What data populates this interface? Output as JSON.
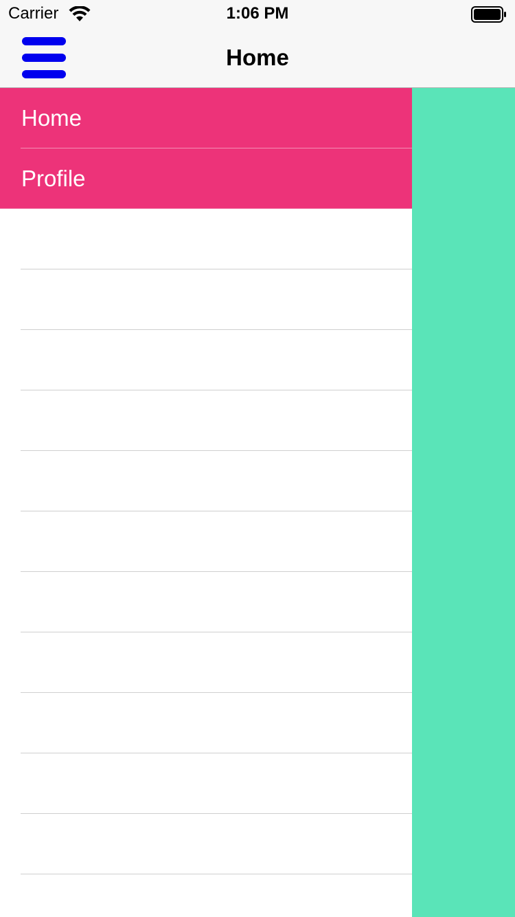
{
  "status_bar": {
    "carrier": "Carrier",
    "time": "1:06 PM",
    "wifi_icon": "wifi-icon",
    "battery_icon": "battery-icon"
  },
  "nav_bar": {
    "title": "Home",
    "menu_icon": "hamburger-menu-icon",
    "menu_icon_color": "#0000ee"
  },
  "side_menu": {
    "accent_color": "#ed3379",
    "items": [
      {
        "label": "Home"
      },
      {
        "label": "Profile"
      }
    ],
    "empty_row_count": 11
  },
  "content": {
    "background_color": "#5ae4b8"
  }
}
